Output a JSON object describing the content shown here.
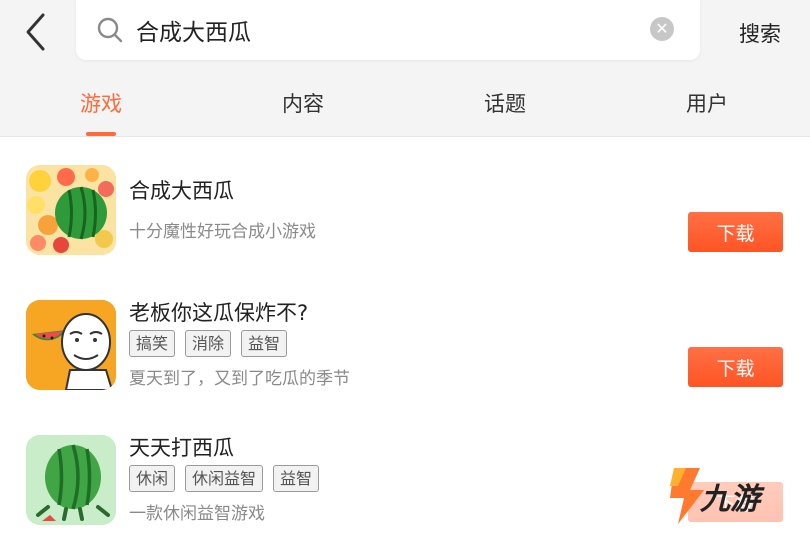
{
  "header": {
    "search_value": "合成大西瓜",
    "search_button": "搜索"
  },
  "tabs": [
    {
      "label": "游戏",
      "active": true
    },
    {
      "label": "内容",
      "active": false
    },
    {
      "label": "话题",
      "active": false
    },
    {
      "label": "用户",
      "active": false
    }
  ],
  "results": [
    {
      "title": "合成大西瓜",
      "desc": "十分魔性好玩合成小游戏",
      "tags": [],
      "action": "下载"
    },
    {
      "title": "老板你这瓜保炸不?",
      "desc": "夏天到了，又到了吃瓜的季节",
      "tags": [
        "搞笑",
        "消除",
        "益智"
      ],
      "action": "下载"
    },
    {
      "title": "天天打西瓜",
      "desc": "一款休闲益智游戏",
      "tags": [
        "休闲",
        "休闲益智",
        "益智"
      ],
      "action": "下载"
    }
  ],
  "watermark": {
    "text": "九游"
  },
  "colors": {
    "accent": "#ff6a3a",
    "button": "#ff5d2e",
    "header_bg": "#f4f4f4"
  }
}
